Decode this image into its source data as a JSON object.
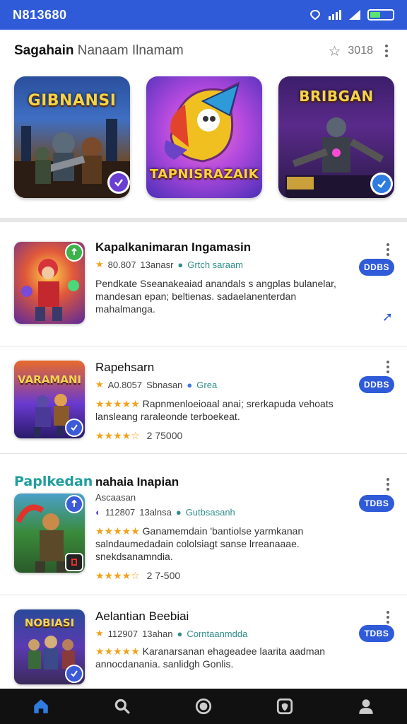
{
  "status_bar": {
    "time": "N813680"
  },
  "header": {
    "title_bold": "Sagahain",
    "title_rest": "Nanaam Ilnamam",
    "rating": "3018"
  },
  "featured": [
    {
      "title": "GIBNANSI",
      "badge": "check"
    },
    {
      "title": "TAPNISRAZAIK",
      "badge": "none"
    },
    {
      "title": "BRIBGAN",
      "badge": "check"
    }
  ],
  "list": [
    {
      "title": "Kapalkanimaran Ingamasin",
      "rating": "80.807",
      "size": "13anasr",
      "category": "Grtch saraam",
      "desc": "Pendkate Sseanakeaiad anandals s angplas bulanelar, mandesan epan; beltienas. sadaelanenterdan mahalmanga.",
      "button": "DDBS"
    },
    {
      "title": "Rapehsarn",
      "thumb_title": "VARAMANI",
      "rating": "A0.8057",
      "size": "Sbnasan",
      "category": "Grea",
      "desc_stars": "★★★★★",
      "desc": "Rapnmenloeioaal anai; srerkapuda vehoats lansleang raraleonde terboekeat.",
      "bottom_stars": "★★★★☆",
      "bottom_rating": "2 75000",
      "button": "DDBS"
    },
    {
      "category_label": "Paplkedan",
      "title": "nahaia Inapian",
      "subtitle": "Ascaasan",
      "rating": "112807",
      "size": "13alnsa",
      "category": "Gutbsasanh",
      "desc_stars": "★★★★★",
      "desc": "Ganamemdain 'bantiolse yarmkanan salndaumedadain cololsiagt sanse lrreanaaae. snekdsanamndia.",
      "bottom_stars": "★★★★☆",
      "bottom_rating": "2 7-500",
      "button": "TDBS"
    },
    {
      "title": "Aelantian Beebiai",
      "thumb_title": "NOBIASI",
      "rating": "112907",
      "size": "13ahan",
      "category": "Corntaanmdda",
      "desc_stars": "★★★★★",
      "desc": "Karanarsanan ehageadee laarita aadman annocdanania. sanlidgh Gonlis.",
      "button": "TDBS"
    }
  ],
  "nav": [
    "home-icon",
    "search-icon",
    "circle-icon",
    "shield-icon",
    "profile-icon"
  ],
  "colors": {
    "accent": "#2f5bd8",
    "star": "#f2a21a",
    "teal": "#1f9e9c"
  }
}
